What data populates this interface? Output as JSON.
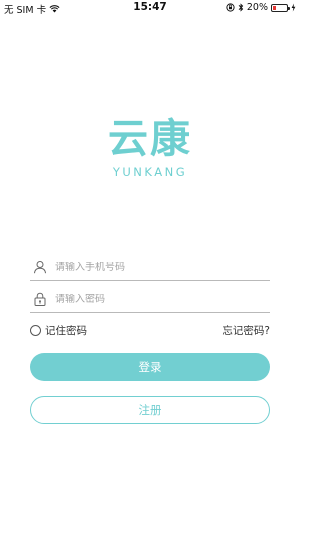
{
  "status_bar": {
    "carrier": "无 SIM 卡",
    "time": "15:47",
    "battery_percent": "20%",
    "battery_level": 0.2,
    "battery_color": "#e53935",
    "icons": [
      "wifi-icon",
      "orientation-lock-icon",
      "bluetooth-icon",
      "battery-icon",
      "charging-icon"
    ]
  },
  "logo": {
    "title_cn": "云康",
    "title_en": "YUNKANG",
    "color": "#6ecfd0"
  },
  "form": {
    "phone": {
      "placeholder": "请输入手机号码",
      "value": "",
      "icon": "user-icon"
    },
    "password": {
      "placeholder": "请输入密码",
      "value": "",
      "icon": "lock-icon"
    },
    "remember_label": "记住密码",
    "remember_checked": false,
    "forgot_label": "忘记密码?"
  },
  "buttons": {
    "login": "登录",
    "register": "注册",
    "accent": "#72cfd1"
  }
}
